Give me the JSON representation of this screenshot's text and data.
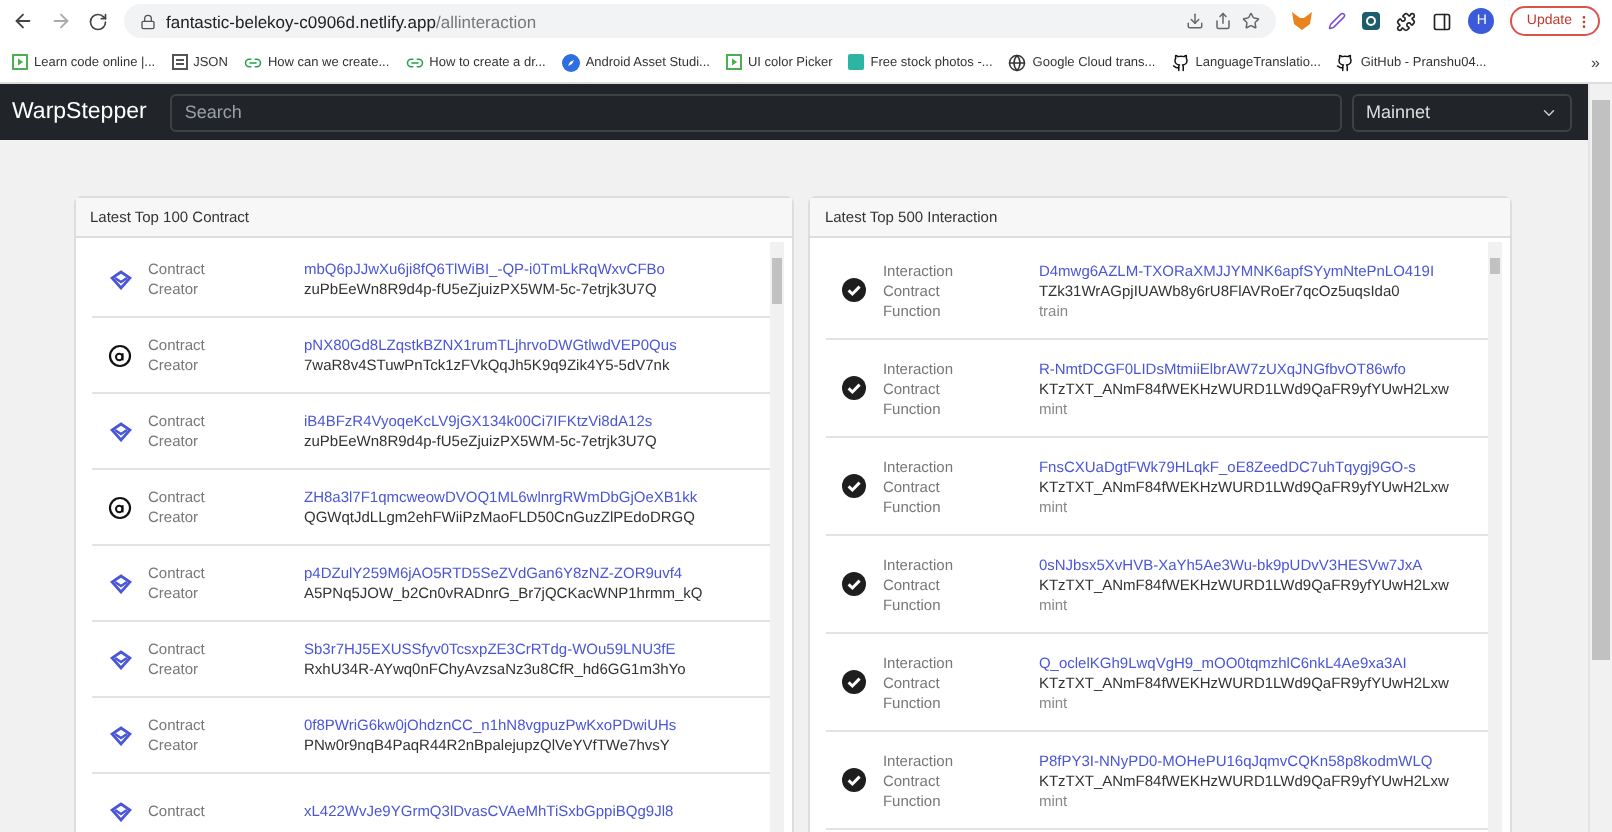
{
  "browser": {
    "url_host": "fantastic-belekoy-c0906d.netlify.app",
    "url_path": "/allinteraction",
    "avatar": "H",
    "update_label": "Update"
  },
  "bookmarks": [
    {
      "label": "Learn code online |...",
      "kind": "play"
    },
    {
      "label": "JSON",
      "kind": "doc"
    },
    {
      "label": "How can we create...",
      "kind": "link"
    },
    {
      "label": "How to create a dr...",
      "kind": "link"
    },
    {
      "label": "Android Asset Studi...",
      "kind": "compass"
    },
    {
      "label": "UI color Picker",
      "kind": "play"
    },
    {
      "label": "Free stock photos -...",
      "kind": "square"
    },
    {
      "label": "Google Cloud trans...",
      "kind": "globe"
    },
    {
      "label": "LanguageTranslatio...",
      "kind": "github"
    },
    {
      "label": "GitHub - Pranshu04...",
      "kind": "github"
    }
  ],
  "bookmarks_more": "»",
  "navbar": {
    "brand": "WarpStepper",
    "search_placeholder": "Search",
    "network": "Mainnet"
  },
  "contracts_panel": {
    "title": "Latest Top 100 Contract",
    "rows": [
      {
        "kind": "diamond",
        "fields": [
          {
            "label": "Contract",
            "value": "mbQ6pJJwXu6ji8fQ6TlWiBI_-QP-i0TmLkRqWxvCFBo",
            "kind": "link"
          },
          {
            "label": "Creator",
            "value": "zuPbEeWn8R9d4p-fU5eZjuizPX5WM-5c-7etrjk3U7Q",
            "kind": "plain"
          }
        ]
      },
      {
        "kind": "letter",
        "fields": [
          {
            "label": "Contract",
            "value": "pNX80Gd8LZqstkBZNX1rumTLjhrvoDWGtlwdVEP0Qus",
            "kind": "link"
          },
          {
            "label": "Creator",
            "value": "7waR8v4STuwPnTck1zFVkQqJh5K9q9Zik4Y5-5dV7nk",
            "kind": "plain"
          }
        ]
      },
      {
        "kind": "diamond",
        "fields": [
          {
            "label": "Contract",
            "value": "iB4BFzR4VyoqeKcLV9jGX134k00Ci7IFKtzVi8dA12s",
            "kind": "link"
          },
          {
            "label": "Creator",
            "value": "zuPbEeWn8R9d4p-fU5eZjuizPX5WM-5c-7etrjk3U7Q",
            "kind": "plain"
          }
        ]
      },
      {
        "kind": "letter",
        "fields": [
          {
            "label": "Contract",
            "value": "ZH8a3l7F1qmcweowDVOQ1ML6wlnrgRWmDbGjOeXB1kk",
            "kind": "link"
          },
          {
            "label": "Creator",
            "value": "QGWqtJdLLgm2ehFWiiPzMaoFLD50CnGuzZlPEdoDRGQ",
            "kind": "plain"
          }
        ]
      },
      {
        "kind": "diamond",
        "fields": [
          {
            "label": "Contract",
            "value": "p4DZulY259M6jAO5RTD5SeZVdGan6Y8zNZ-ZOR9uvf4",
            "kind": "link"
          },
          {
            "label": "Creator",
            "value": "A5PNq5JOW_b2Cn0vRADnrG_Br7jQCKacWNP1hrmm_kQ",
            "kind": "plain"
          }
        ]
      },
      {
        "kind": "diamond",
        "fields": [
          {
            "label": "Contract",
            "value": "Sb3r7HJ5EXUSSfyv0TcsxpZE3CrRTdg-WOu59LNU3fE",
            "kind": "link"
          },
          {
            "label": "Creator",
            "value": "RxhU34R-AYwq0nFChyAvzsaNz3u8CfR_hd6GG1m3hYo",
            "kind": "plain"
          }
        ]
      },
      {
        "kind": "diamond",
        "fields": [
          {
            "label": "Contract",
            "value": "0f8PWriG6kw0jOhdznCC_n1hN8vgpuzPwKxoPDwiUHs",
            "kind": "link"
          },
          {
            "label": "Creator",
            "value": "PNw0r9nqB4PaqR44R2nBpalejupzQlVeYVfTWe7hvsY",
            "kind": "plain"
          }
        ]
      },
      {
        "kind": "diamond",
        "fields": [
          {
            "label": "Contract",
            "value": "xL422WvJe9YGrmQ3lDvasCVAeMhTiSxbGppiBQg9Jl8",
            "kind": "link"
          }
        ]
      }
    ]
  },
  "interactions_panel": {
    "title": "Latest Top 500 Interaction",
    "rows": [
      {
        "kind": "check",
        "fields": [
          {
            "label": "Interaction",
            "value": "D4mwg6AZLM-TXORaXMJJYMNK6apfSYymNtePnLO419I",
            "kind": "link"
          },
          {
            "label": "Contract",
            "value": "TZk31WrAGpjIUAWb8y6rU8FlAVRoEr7qcOz5uqsIda0",
            "kind": "plain"
          },
          {
            "label": "Function",
            "value": "train",
            "kind": "muted"
          }
        ]
      },
      {
        "kind": "check",
        "fields": [
          {
            "label": "Interaction",
            "value": "R-NmtDCGF0LIDsMtmiiElbrAW7zUXqJNGfbvOT86wfo",
            "kind": "link"
          },
          {
            "label": "Contract",
            "value": "KTzTXT_ANmF84fWEKHzWURD1LWd9QaFR9yfYUwH2Lxw",
            "kind": "plain"
          },
          {
            "label": "Function",
            "value": "mint",
            "kind": "muted"
          }
        ]
      },
      {
        "kind": "check",
        "fields": [
          {
            "label": "Interaction",
            "value": "FnsCXUaDgtFWk79HLqkF_oE8ZeedDC7uhTqygj9GO-s",
            "kind": "link"
          },
          {
            "label": "Contract",
            "value": "KTzTXT_ANmF84fWEKHzWURD1LWd9QaFR9yfYUwH2Lxw",
            "kind": "plain"
          },
          {
            "label": "Function",
            "value": "mint",
            "kind": "muted"
          }
        ]
      },
      {
        "kind": "check",
        "fields": [
          {
            "label": "Interaction",
            "value": "0sNJbsx5XvHVB-XaYh5Ae3Wu-bk9pUDvV3HESVw7JxA",
            "kind": "link"
          },
          {
            "label": "Contract",
            "value": "KTzTXT_ANmF84fWEKHzWURD1LWd9QaFR9yfYUwH2Lxw",
            "kind": "plain"
          },
          {
            "label": "Function",
            "value": "mint",
            "kind": "muted"
          }
        ]
      },
      {
        "kind": "check",
        "fields": [
          {
            "label": "Interaction",
            "value": "Q_oclelKGh9LwqVgH9_mOO0tqmzhlC6nkL4Ae9xa3AI",
            "kind": "link"
          },
          {
            "label": "Contract",
            "value": "KTzTXT_ANmF84fWEKHzWURD1LWd9QaFR9yfYUwH2Lxw",
            "kind": "plain"
          },
          {
            "label": "Function",
            "value": "mint",
            "kind": "muted"
          }
        ]
      },
      {
        "kind": "check",
        "fields": [
          {
            "label": "Interaction",
            "value": "P8fPY3I-NNyPD0-MOHePU16qJqmvCQKn58p8kodmWLQ",
            "kind": "link"
          },
          {
            "label": "Contract",
            "value": "KTzTXT_ANmF84fWEKHzWURD1LWd9QaFR9yfYUwH2Lxw",
            "kind": "plain"
          },
          {
            "label": "Function",
            "value": "mint",
            "kind": "muted"
          }
        ]
      }
    ]
  }
}
